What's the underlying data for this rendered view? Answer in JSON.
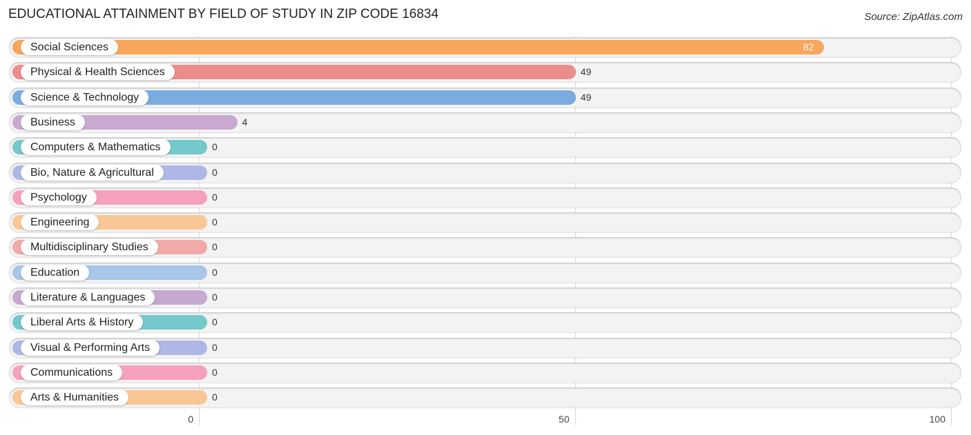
{
  "title": "EDUCATIONAL ATTAINMENT BY FIELD OF STUDY IN ZIP CODE 16834",
  "source": "Source: ZipAtlas.com",
  "chart_data": {
    "type": "bar",
    "orientation": "horizontal",
    "title": "EDUCATIONAL ATTAINMENT BY FIELD OF STUDY IN ZIP CODE 16834",
    "xlabel": "",
    "ylabel": "",
    "xlim": [
      0,
      100
    ],
    "xticks": [
      "0",
      "50",
      "100"
    ],
    "grid": true,
    "categories": [
      "Social Sciences",
      "Physical & Health Sciences",
      "Science & Technology",
      "Business",
      "Computers & Mathematics",
      "Bio, Nature & Agricultural",
      "Psychology",
      "Engineering",
      "Multidisciplinary Studies",
      "Education",
      "Literature & Languages",
      "Liberal Arts & History",
      "Visual & Performing Arts",
      "Communications",
      "Arts & Humanities"
    ],
    "values": [
      82,
      49,
      49,
      4,
      0,
      0,
      0,
      0,
      0,
      0,
      0,
      0,
      0,
      0,
      0
    ],
    "value_labels": [
      "82",
      "49",
      "49",
      "4",
      "0",
      "0",
      "0",
      "0",
      "0",
      "0",
      "0",
      "0",
      "0",
      "0",
      "0"
    ],
    "colors": [
      "#f7a65c",
      "#ec8d8d",
      "#7aace2",
      "#c8a9cf",
      "#72c8ca",
      "#aeb7e6",
      "#f5a1bd",
      "#f9c795",
      "#f1aaa8",
      "#a7c6ea",
      "#c5a9d0",
      "#72c8ca",
      "#aeb7e6",
      "#f5a1bd",
      "#f9c795"
    ]
  }
}
